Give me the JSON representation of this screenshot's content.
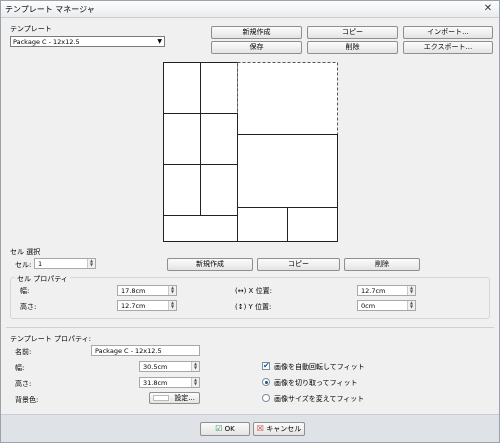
{
  "window": {
    "title": "テンプレート マネージャ",
    "close_glyph": "✕"
  },
  "template": {
    "label": "テンプレート",
    "selected": "Package C - 12x12.5"
  },
  "top_buttons": {
    "new": "新規作成",
    "copy": "コピー",
    "import": "インポート...",
    "save": "保存",
    "delete": "削除",
    "export": "エクスポート..."
  },
  "cell_select": {
    "title": "セル 選択",
    "cell_label": "セル:",
    "cell_value": "1",
    "new": "新規作成",
    "copy": "コピー",
    "delete": "削除"
  },
  "cell_props": {
    "title": "セル プロパティ",
    "width_label": "幅:",
    "width_value": "17.8cm",
    "height_label": "高さ:",
    "height_value": "12.7cm",
    "x_label": "(↔) X 位置:",
    "x_value": "12.7cm",
    "y_label": "(↕) Y 位置:",
    "y_value": "0cm"
  },
  "template_props": {
    "title": "テンプレート プロパティ:",
    "name_label": "名前:",
    "name_value": "Package C - 12x12.5",
    "width_label": "幅:",
    "width_value": "30.5cm",
    "height_label": "高さ:",
    "height_value": "31.8cm",
    "bg_label": "背景色:",
    "bg_button": "設定...",
    "opt_rotate": "画像を自動回転してフィット",
    "opt_crop": "画像を切り取ってフィット",
    "opt_resize": "画像サイズを変えてフィット",
    "rotate_checked": true,
    "fit_mode": "crop"
  },
  "footer": {
    "ok": "OK",
    "cancel": "キャンセル"
  },
  "colors": {
    "accent_ok": "#2e8b57",
    "accent_cancel": "#c0392b"
  }
}
